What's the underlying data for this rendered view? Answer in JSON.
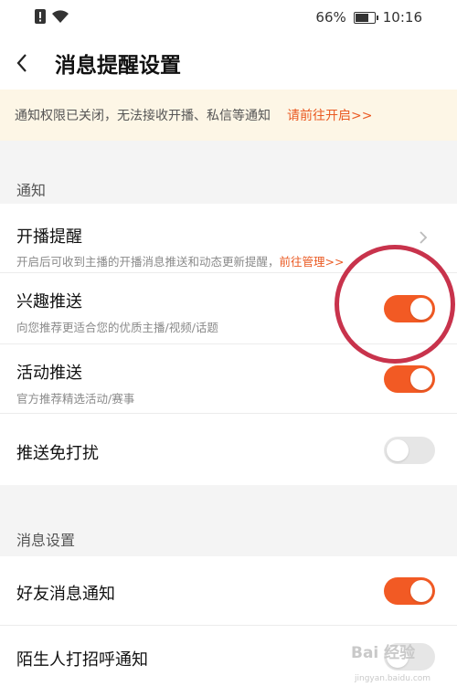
{
  "status_bar": {
    "battery": "66%",
    "time": "10:16",
    "battery_level": 0.66
  },
  "header": {
    "title": "消息提醒设置"
  },
  "banner": {
    "text": "通知权限已关闭，无法接收开播、私信等通知",
    "link": "请前往开启>>"
  },
  "sections": {
    "notify": {
      "label": "通知"
    },
    "message": {
      "label": "消息设置"
    }
  },
  "rows": {
    "live_reminder": {
      "title": "开播提醒",
      "subtitle": "开启后可收到主播的开播消息推送和动态更新提醒，",
      "link": "前往管理>>"
    },
    "interest_push": {
      "title": "兴趣推送",
      "subtitle": "向您推荐更适合您的优质主播/视频/话题",
      "enabled": true
    },
    "activity_push": {
      "title": "活动推送",
      "subtitle": "官方推荐精选活动/赛事",
      "enabled": true
    },
    "dnd_push": {
      "title": "推送免打扰",
      "enabled": false
    },
    "friend_msg": {
      "title": "好友消息通知",
      "enabled": true
    },
    "stranger_greet": {
      "title": "陌生人打招呼通知",
      "enabled": false
    }
  },
  "watermark": {
    "text": "Bai 经验",
    "sub": "jingyan.baidu.com"
  },
  "colors": {
    "accent": "#f25a24",
    "banner_bg": "#fdf6e6",
    "annotation": "#c8334c"
  }
}
